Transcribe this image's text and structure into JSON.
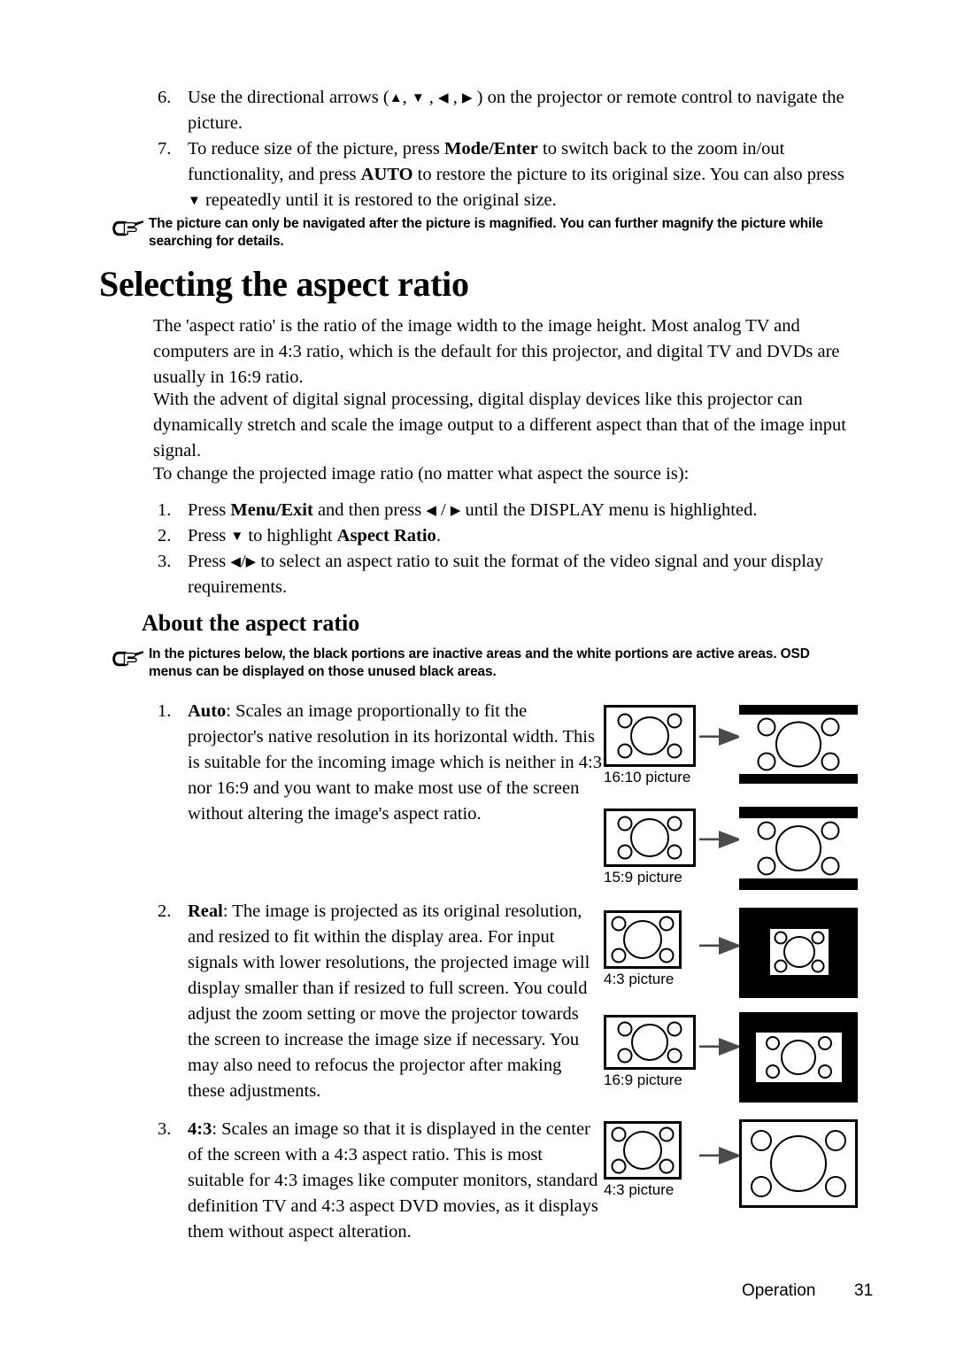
{
  "page": {
    "footer_label": "Operation",
    "footer_page_number": "31",
    "background": "#ffffff",
    "text_color": "#000000",
    "arrow_color": "#4a4a4a"
  },
  "top_steps": [
    {
      "number": "6.",
      "text_parts": [
        {
          "t": "Use the directional arrows (",
          "style": "normal"
        },
        {
          "t": "▲",
          "style": "glyph"
        },
        {
          "t": ", ",
          "style": "normal"
        },
        {
          "t": "▼",
          "style": "glyph"
        },
        {
          "t": " , ",
          "style": "normal"
        },
        {
          "t": "◀",
          "style": "glyph"
        },
        {
          "t": " , ",
          "style": "normal"
        },
        {
          "t": "▶",
          "style": "glyph"
        },
        {
          "t": " ) on the projector or remote control to navigate the picture.",
          "style": "normal"
        }
      ]
    },
    {
      "number": "7.",
      "text_parts": [
        {
          "t": "To reduce size of the picture, press ",
          "style": "normal"
        },
        {
          "t": "Mode/Enter",
          "style": "bold"
        },
        {
          "t": " to switch back to the zoom in/out functionality, and press ",
          "style": "normal"
        },
        {
          "t": "AUTO",
          "style": "bold"
        },
        {
          "t": " to restore the picture to its original size. You can also press ",
          "style": "normal"
        },
        {
          "t": "▼",
          "style": "glyph"
        },
        {
          "t": " repeatedly until it is restored to the original size.",
          "style": "normal"
        }
      ]
    }
  ],
  "note_1": {
    "icon": "pointing-hand-icon",
    "text": "The picture can only be navigated after the picture is magnified. You can further magnify the picture while searching for details."
  },
  "heading_main": "Selecting the aspect ratio",
  "paragraphs": [
    "The 'aspect ratio' is the ratio of the image width to the image height. Most analog TV and computers are in 4:3 ratio, which is the default for this projector, and digital TV and DVDs are usually in 16:9 ratio.",
    "With the advent of digital signal processing, digital display devices like this projector can dynamically stretch and scale the image output to a different aspect than that of the image input signal.",
    "To change the projected image ratio (no matter what aspect the source is):"
  ],
  "change_steps": [
    {
      "number": "1.",
      "text_parts": [
        {
          "t": "Press ",
          "style": "normal"
        },
        {
          "t": "Menu/Exit",
          "style": "bold"
        },
        {
          "t": " and then press ",
          "style": "normal"
        },
        {
          "t": "◀",
          "style": "glyph"
        },
        {
          "t": " / ",
          "style": "normal"
        },
        {
          "t": "▶",
          "style": "glyph"
        },
        {
          "t": " until the ",
          "style": "normal"
        },
        {
          "t": "DISPLAY",
          "style": "normal"
        },
        {
          "t": " menu is highlighted.",
          "style": "normal"
        }
      ]
    },
    {
      "number": "2.",
      "text_parts": [
        {
          "t": "Press ",
          "style": "normal"
        },
        {
          "t": "▼",
          "style": "glyph"
        },
        {
          "t": " to highlight ",
          "style": "normal"
        },
        {
          "t": "Aspect Ratio",
          "style": "bold"
        },
        {
          "t": ".",
          "style": "normal"
        }
      ]
    },
    {
      "number": "3.",
      "text_parts": [
        {
          "t": "Press ",
          "style": "normal"
        },
        {
          "t": "◀",
          "style": "glyph"
        },
        {
          "t": "/",
          "style": "normal"
        },
        {
          "t": "▶",
          "style": "glyph"
        },
        {
          "t": " to select an aspect ratio to suit the format of the video signal and your display requirements.",
          "style": "normal"
        }
      ]
    }
  ],
  "heading_sub": "About the aspect ratio",
  "note_2": {
    "icon": "pointing-hand-icon",
    "text": "In the pictures below, the black portions are inactive areas and the white portions are active areas. OSD menus can be displayed on those unused black areas."
  },
  "aspect_items": [
    {
      "number": "1.",
      "term": "Auto",
      "body": ": Scales an image proportionally to fit the projector's native resolution in its horizontal width. This is suitable for the incoming image which is neither in 4:3 nor 16:9 and you want to make most use of the screen without altering the image's aspect ratio."
    },
    {
      "number": "2.",
      "term": "Real",
      "body": ": The image is projected as its original resolution, and resized to fit within the display area. For input signals with lower resolutions, the projected image will display smaller than if resized to full screen. You could adjust the zoom setting or move the projector towards the screen to increase the image size if necessary. You may also need to refocus the projector after making these adjustments."
    },
    {
      "number": "3.",
      "term": "4:3",
      "body": ": Scales an image so that it is displayed in the center of the screen with a 4:3 aspect ratio. This is most suitable for 4:3 images like computer monitors, standard definition TV and 4:3 aspect DVD movies, as it displays them without aspect alteration."
    }
  ],
  "figures": [
    {
      "id": "fig-16-10",
      "caption": "16:10 picture",
      "source_ratio": "16:10",
      "result_bars": "horizontal",
      "result_fill": "white-with-top-bottom-black-bars"
    },
    {
      "id": "fig-15-9",
      "caption": "15:9 picture",
      "source_ratio": "15:9",
      "result_bars": "horizontal",
      "result_fill": "white-with-top-bottom-black-bars"
    },
    {
      "id": "fig-4-3-real",
      "caption": "4:3 picture",
      "source_ratio": "4:3",
      "result_bars": "all-around",
      "result_fill": "small-white-picture-on-black"
    },
    {
      "id": "fig-16-9-real",
      "caption": "16:9 picture",
      "source_ratio": "16:9",
      "result_bars": "all-around",
      "result_fill": "small-white-picture-on-black"
    },
    {
      "id": "fig-4-3-scaled",
      "caption": "4:3 picture",
      "source_ratio": "4:3",
      "result_bars": "none",
      "result_fill": "full-white"
    }
  ]
}
